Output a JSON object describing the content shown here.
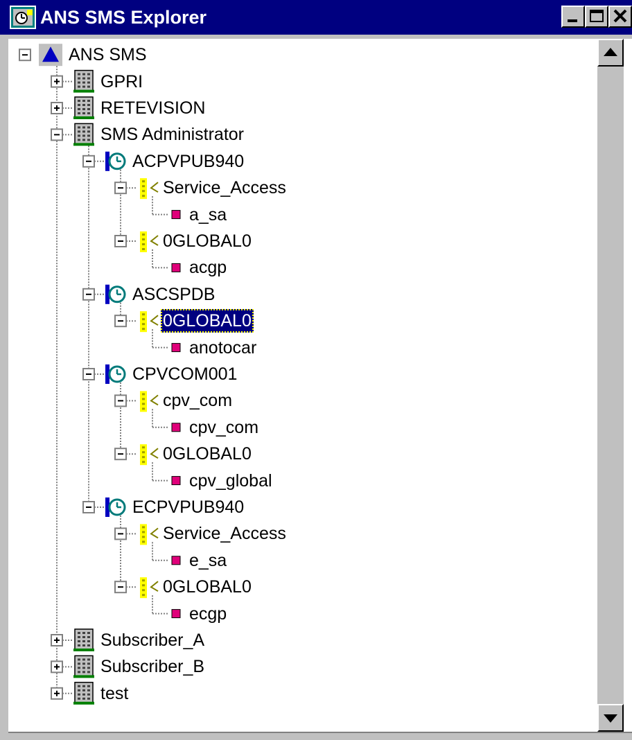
{
  "window": {
    "title": "ANS SMS Explorer",
    "title_bar_color": "#000080",
    "controls": [
      "minimize-icon",
      "maximize-icon",
      "close-icon"
    ]
  },
  "tree": {
    "nodes": [
      {
        "label": "ANS SMS",
        "icon": "network-root-icon",
        "depth": 0,
        "expander": "minus"
      },
      {
        "label": "GPRI",
        "icon": "building-icon",
        "depth": 1,
        "expander": "plus"
      },
      {
        "label": "RETEVISION",
        "icon": "building-icon",
        "depth": 1,
        "expander": "plus"
      },
      {
        "label": "SMS Administrator",
        "icon": "building-icon",
        "depth": 1,
        "expander": "minus"
      },
      {
        "label": "ACPVPUB940",
        "icon": "database-server-icon",
        "depth": 2,
        "expander": "minus"
      },
      {
        "label": "Service_Access",
        "icon": "schema-icon",
        "depth": 3,
        "expander": "minus"
      },
      {
        "label": "a_sa",
        "icon": "table-icon",
        "depth": 4,
        "expander": "none"
      },
      {
        "label": "0GLOBAL0",
        "icon": "schema-icon",
        "depth": 3,
        "expander": "minus"
      },
      {
        "label": "acgp",
        "icon": "table-icon",
        "depth": 4,
        "expander": "none"
      },
      {
        "label": "ASCSPDB",
        "icon": "database-server-icon",
        "depth": 2,
        "expander": "minus"
      },
      {
        "label": "0GLOBAL0",
        "icon": "schema-icon",
        "depth": 3,
        "expander": "minus",
        "selected": true
      },
      {
        "label": "anotocar",
        "icon": "table-icon",
        "depth": 4,
        "expander": "none"
      },
      {
        "label": "CPVCOM001",
        "icon": "database-server-icon",
        "depth": 2,
        "expander": "minus"
      },
      {
        "label": "cpv_com",
        "icon": "schema-icon",
        "depth": 3,
        "expander": "minus"
      },
      {
        "label": "cpv_com",
        "icon": "table-icon",
        "depth": 4,
        "expander": "none"
      },
      {
        "label": "0GLOBAL0",
        "icon": "schema-icon",
        "depth": 3,
        "expander": "minus"
      },
      {
        "label": "cpv_global",
        "icon": "table-icon",
        "depth": 4,
        "expander": "none"
      },
      {
        "label": "ECPVPUB940",
        "icon": "database-server-icon",
        "depth": 2,
        "expander": "minus"
      },
      {
        "label": "Service_Access",
        "icon": "schema-icon",
        "depth": 3,
        "expander": "minus"
      },
      {
        "label": "e_sa",
        "icon": "table-icon",
        "depth": 4,
        "expander": "none"
      },
      {
        "label": "0GLOBAL0",
        "icon": "schema-icon",
        "depth": 3,
        "expander": "minus"
      },
      {
        "label": "ecgp",
        "icon": "table-icon",
        "depth": 4,
        "expander": "none"
      },
      {
        "label": "Subscriber_A",
        "icon": "building-icon",
        "depth": 1,
        "expander": "plus"
      },
      {
        "label": "Subscriber_B",
        "icon": "building-icon",
        "depth": 1,
        "expander": "plus"
      },
      {
        "label": "test",
        "icon": "building-icon",
        "depth": 1,
        "expander": "plus"
      }
    ],
    "colors": {
      "selection_background": "#000080",
      "selection_text": "#ffffff",
      "table_icon": "#e0007a",
      "schema_icon": "#ffff00",
      "root_icon": "#0000c0",
      "server_icon": "#007a7a"
    }
  },
  "scrollbar": {
    "up_icon": "scroll-up-arrow-icon",
    "down_icon": "scroll-down-arrow-icon"
  }
}
